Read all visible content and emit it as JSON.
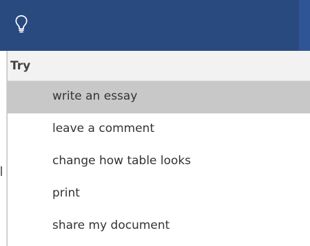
{
  "search_bar": {
    "icon": "lightbulb-icon",
    "colors": {
      "background": "#294a7e",
      "edge": "#2f5597"
    }
  },
  "dropdown": {
    "header": "Try",
    "items": [
      {
        "label": "write an essay",
        "selected": true
      },
      {
        "label": "leave a comment",
        "selected": false
      },
      {
        "label": "change how table looks",
        "selected": false
      },
      {
        "label": "print",
        "selected": false
      },
      {
        "label": "share my document",
        "selected": false
      }
    ]
  }
}
